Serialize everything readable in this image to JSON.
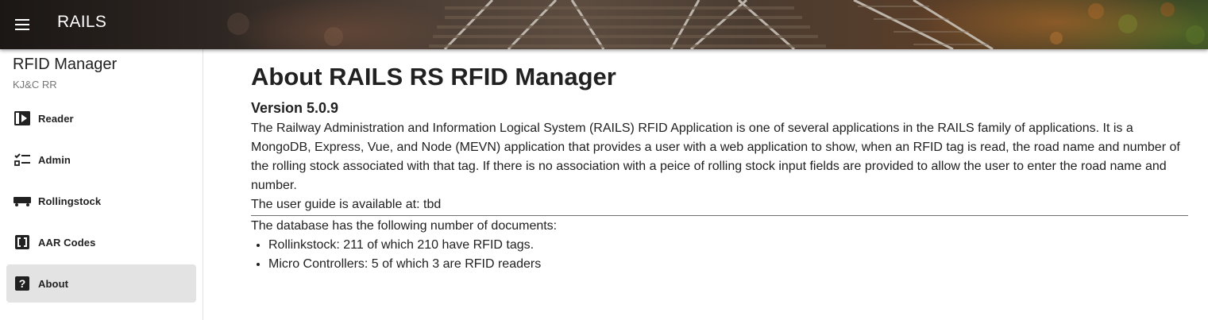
{
  "app_bar": {
    "title": "RAILS",
    "menu_icon": "menu-icon"
  },
  "sidebar": {
    "title": "RFID Manager",
    "subtitle": "KJ&C RR",
    "items": [
      {
        "label": "Reader",
        "icon": "reader-icon",
        "active": false
      },
      {
        "label": "Admin",
        "icon": "checklist-icon",
        "active": false
      },
      {
        "label": "Rollingstock",
        "icon": "railcar-icon",
        "active": false
      },
      {
        "label": "AAR Codes",
        "icon": "code-brackets-icon",
        "active": false
      },
      {
        "label": "About",
        "icon": "help-icon",
        "active": true
      }
    ]
  },
  "main": {
    "title": "About RAILS RS RFID Manager",
    "version": "Version 5.0.9",
    "description": "The Railway Administration and Information Logical System (RAILS) RFID Application is one of several applications in the RAILS family of applications. It is a MongoDB, Express, Vue, and Node (MEVN) application that provides a user with a web application to show, when an RFID tag is read, the road name and number of the rolling stock associated with that tag. If there is no association with a peice of rolling stock input fields are provided to allow the user to enter the road name and number.",
    "user_guide": "The user guide is available at: tbd",
    "db_heading": "The database has the following number of documents:",
    "db_items": [
      "Rollinkstock: 211 of which 210 have RFID tags.",
      "Micro Controllers: 5 of which 3 are RFID readers"
    ]
  },
  "colors": {
    "active_nav_bg": "#e3e3e3",
    "text": "#212121",
    "subtitle": "#757575"
  }
}
